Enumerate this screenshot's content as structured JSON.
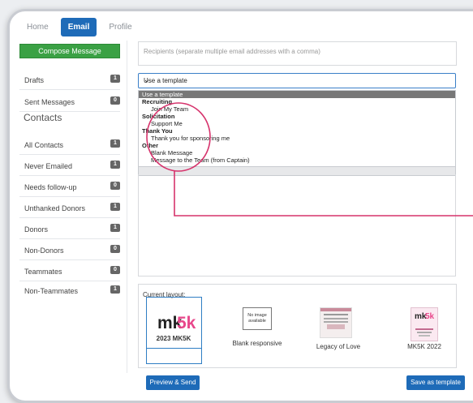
{
  "tabs": [
    {
      "label": "Home",
      "active": false
    },
    {
      "label": "Email",
      "active": true
    },
    {
      "label": "Profile",
      "active": false
    }
  ],
  "compose_label": "Compose Message",
  "mailbox": [
    {
      "label": "Drafts",
      "count": "1"
    },
    {
      "label": "Sent Messages",
      "count": "0"
    }
  ],
  "contacts_heading": "Contacts",
  "contacts": [
    {
      "label": "All Contacts",
      "count": "1"
    },
    {
      "label": "Never Emailed",
      "count": "1"
    },
    {
      "label": "Needs follow-up",
      "count": "0"
    },
    {
      "label": "Unthanked Donors",
      "count": "1"
    },
    {
      "label": "Donors",
      "count": "1"
    },
    {
      "label": "Non-Donors",
      "count": "0"
    },
    {
      "label": "Teammates",
      "count": "0"
    },
    {
      "label": "Non-Teammates",
      "count": "1"
    }
  ],
  "recipients_placeholder": "Recipients (separate multiple email addresses with a comma)",
  "template_select": {
    "value": "Use a template",
    "options_header": "Use a template",
    "groups": [
      {
        "label": "Recruiting",
        "options": [
          "Join My Team"
        ]
      },
      {
        "label": "Solicitation",
        "options": [
          "Support Me"
        ]
      },
      {
        "label": "Thank You",
        "options": [
          "Thank you for sponsoring me"
        ]
      },
      {
        "label": "Other",
        "options": [
          "Blank Message",
          "Message to the Team (from Captain)"
        ]
      }
    ]
  },
  "layout": {
    "label": "Current layout:",
    "items": [
      {
        "name": "2023 MK5K",
        "logo": "mk5k"
      },
      {
        "name": "Blank responsive",
        "placeholder": "No image available"
      },
      {
        "name": "Legacy of Love"
      },
      {
        "name": "MK5K 2022",
        "logo": "mk5k"
      }
    ]
  },
  "buttons": {
    "preview": "Preview & Send",
    "save": "Save as template"
  },
  "colors": {
    "primary": "#1e6bb8",
    "compose": "#3aa144",
    "annotation": "#d6336c",
    "brand_pink": "#e8478b"
  }
}
